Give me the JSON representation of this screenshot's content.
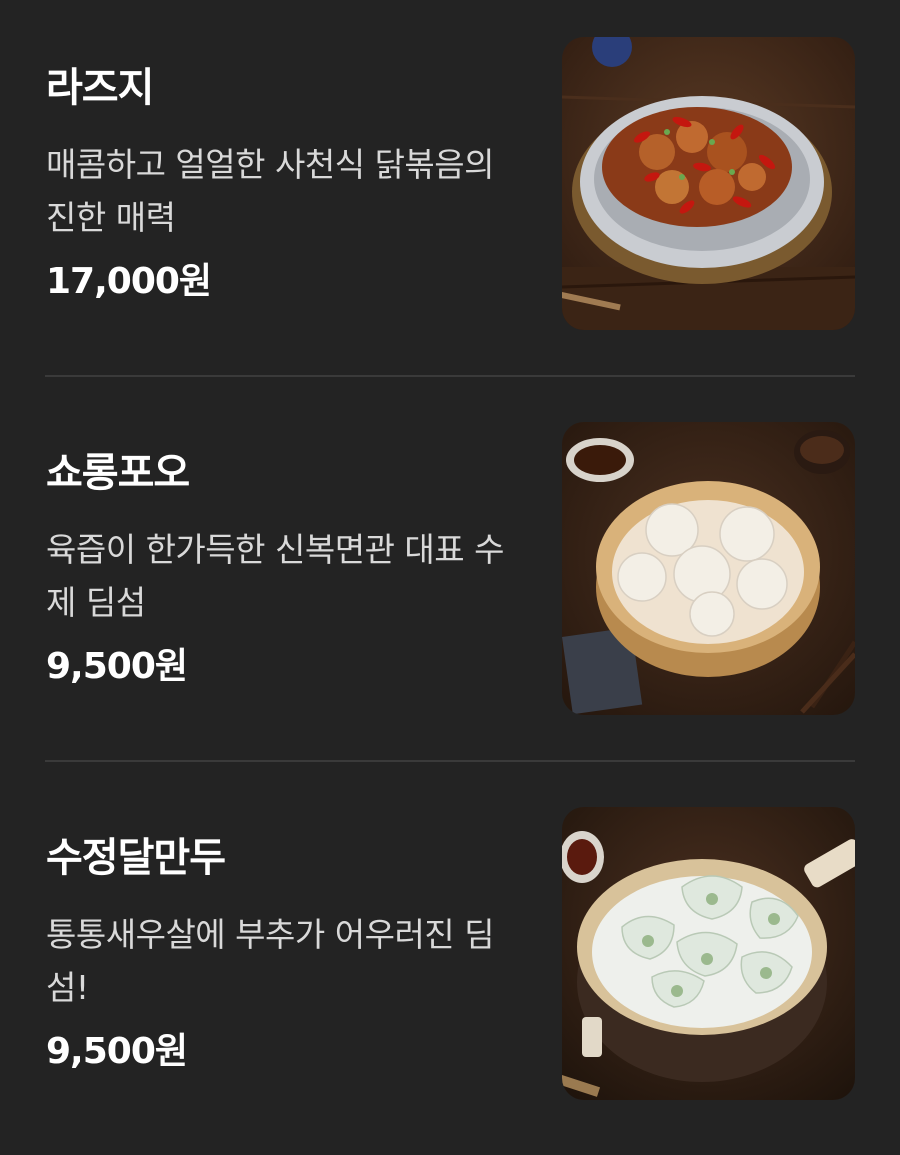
{
  "menu": {
    "items": [
      {
        "name": "라즈지",
        "description": "매콤하고 얼얼한 사천식 닭볶음의 진한 매력",
        "price": "17,000원",
        "image_icon": "spicy-chicken-dish-photo"
      },
      {
        "name": "쇼롱포오",
        "description": "육즙이 한가득한 신복면관 대표 수제 딤섬",
        "price": "9,500원",
        "image_icon": "soup-dumplings-steamer-photo"
      },
      {
        "name": "수정달만두",
        "description": "통통새우살에 부추가 어우러진 딤섬!",
        "price": "9,500원",
        "image_icon": "crystal-dumplings-steamer-photo"
      }
    ]
  }
}
